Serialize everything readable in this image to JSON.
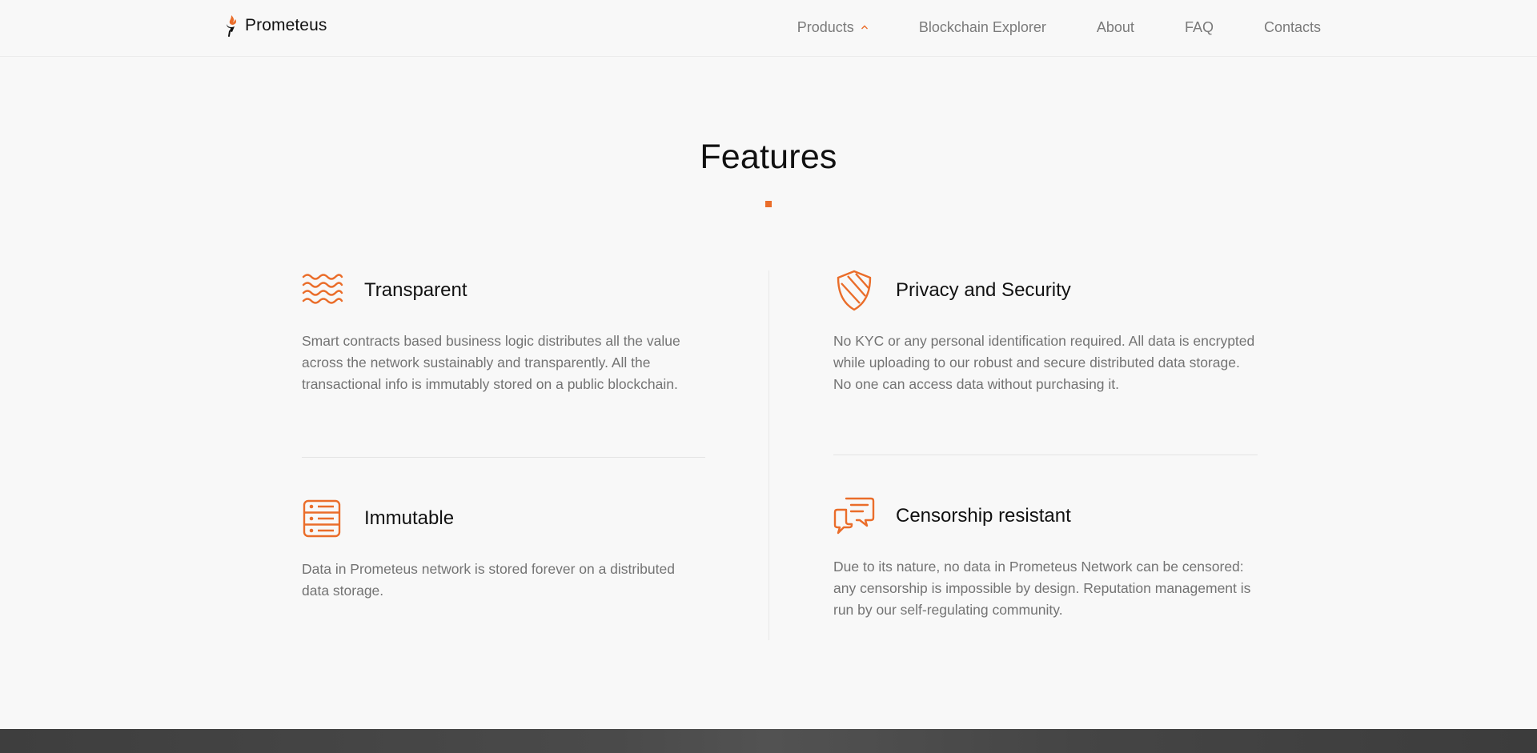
{
  "header": {
    "brand": "Prometeus",
    "nav": {
      "products": "Products",
      "explorer": "Blockchain Explorer",
      "about": "About",
      "faq": "FAQ",
      "contacts": "Contacts"
    }
  },
  "section": {
    "title": "Features"
  },
  "features": [
    {
      "title": "Transparent",
      "description": "Smart contracts based business logic distributes all the value across the network sustainably and transparently. All the transactional info is immutably stored on a public blockchain.",
      "icon": "waves-icon"
    },
    {
      "title": "Privacy and Security",
      "description": "No KYC or any personal identification required. All data is encrypted while uploading to our robust and secure distributed data storage. No one can access data without purchasing it.",
      "icon": "shield-icon"
    },
    {
      "title": "Immutable",
      "description": "Data in Prometeus network is stored forever on a distributed data storage.",
      "icon": "server-icon"
    },
    {
      "title": "Censorship resistant",
      "description": "Due to its nature, no data in Prometeus Network can be censored: any censorship is impossible by design. Reputation management is run by our self-regulating community.",
      "icon": "chat-icon"
    }
  ],
  "colors": {
    "accent": "#ea6d2a",
    "text": "#111111",
    "muted": "#737373",
    "background": "#f8f8f8"
  }
}
